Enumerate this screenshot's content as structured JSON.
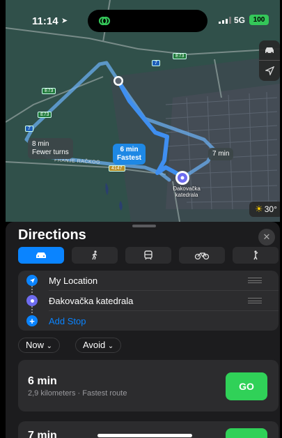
{
  "status_bar": {
    "time": "11:14",
    "network": "5G",
    "battery": "100"
  },
  "map": {
    "route_alt1": {
      "time": "8 min",
      "note": "Fewer turns"
    },
    "route_fastest": {
      "time": "6 min",
      "note": "Fastest"
    },
    "route_alt2": {
      "time": "7 min"
    },
    "road_name": "FRANJE RAČKOG",
    "shields": [
      "E73",
      "E73",
      "E73",
      "7",
      "7",
      "4147"
    ],
    "destination_label": "Đakovačka katedrala",
    "weather": "30°",
    "colors": {
      "route_primary": "#4a9cff",
      "route_alt": "#6aaef0",
      "map_bg": "#2f4b45"
    }
  },
  "sheet": {
    "title": "Directions",
    "modes": [
      "car-icon",
      "walk-icon",
      "transit-icon",
      "bike-icon",
      "rideshare-icon"
    ],
    "waypoints": [
      {
        "label": "My Location"
      },
      {
        "label": "Đakovačka katedrala"
      },
      {
        "label": "Add Stop"
      }
    ],
    "chips": {
      "now": "Now",
      "avoid": "Avoid"
    },
    "routes": [
      {
        "time": "6 min",
        "detail": "2,9 kilometers · Fastest route",
        "go": "GO"
      },
      {
        "time": "7 min"
      }
    ]
  }
}
